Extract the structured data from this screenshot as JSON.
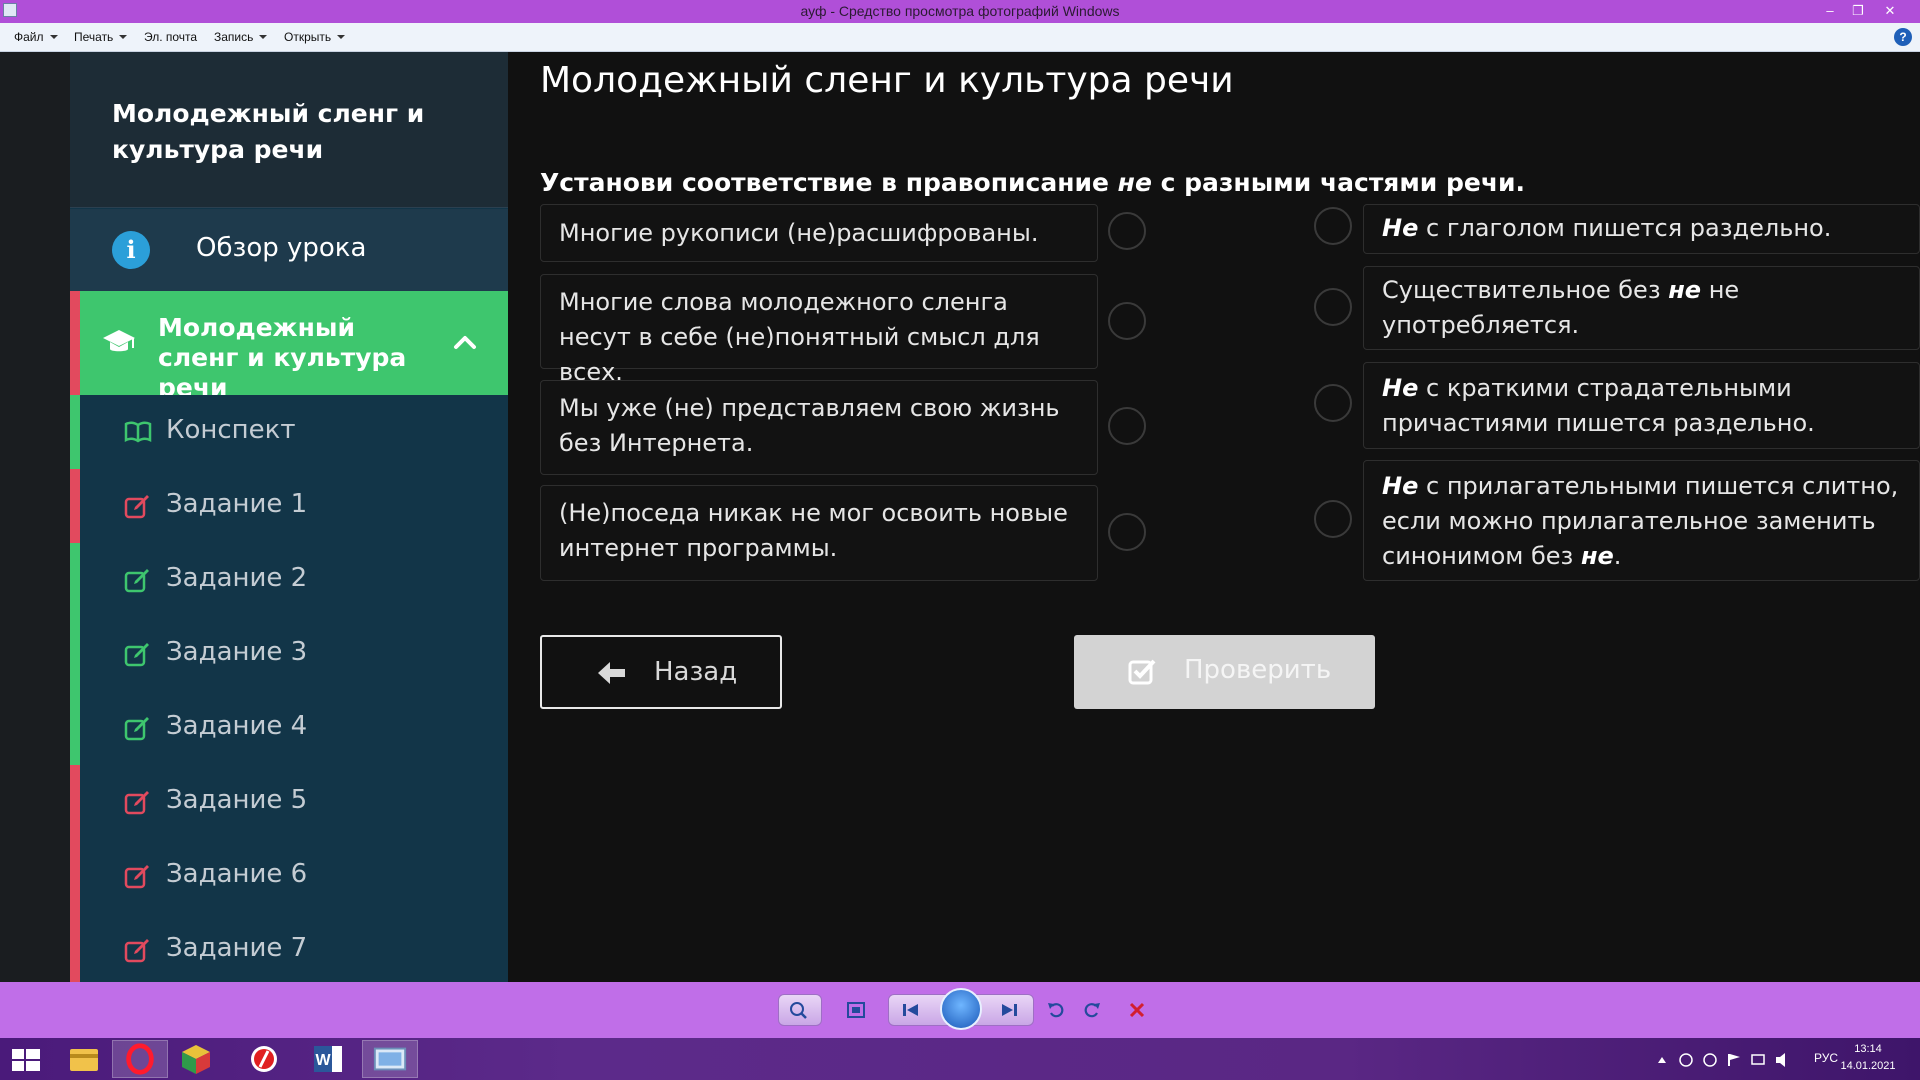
{
  "window": {
    "title": "ауф - Средство просмотра фотографий Windows"
  },
  "menu": {
    "items": [
      {
        "label": "Файл",
        "has_caret": true
      },
      {
        "label": "Печать",
        "has_caret": true
      },
      {
        "label": "Эл. почта",
        "has_caret": false
      },
      {
        "label": "Запись",
        "has_caret": true
      },
      {
        "label": "Открыть",
        "has_caret": true
      }
    ],
    "help_label": "?"
  },
  "sidebar": {
    "course_title": "Молодежный сленг и культура речи",
    "overview_label": "Обзор урока",
    "active_section_label": "Молодежный сленг и культура речи",
    "items": [
      {
        "label": "Конспект",
        "icon": "book-icon",
        "status_color": "#3ec66e"
      },
      {
        "label": "Задание 1",
        "icon": "edit-icon",
        "status_color": "#e24a5e"
      },
      {
        "label": "Задание 2",
        "icon": "edit-icon",
        "status_color": "#3ec66e"
      },
      {
        "label": "Задание 3",
        "icon": "edit-icon",
        "status_color": "#3ec66e"
      },
      {
        "label": "Задание 4",
        "icon": "edit-icon",
        "status_color": "#3ec66e"
      },
      {
        "label": "Задание 5",
        "icon": "edit-icon",
        "status_color": "#e24a5e"
      },
      {
        "label": "Задание 6",
        "icon": "edit-icon",
        "status_color": "#e24a5e"
      },
      {
        "label": "Задание 7",
        "icon": "edit-icon",
        "status_color": "#e24a5e"
      }
    ]
  },
  "main": {
    "page_title": "Молодежный сленг и культура речи",
    "instruction_before": "Установи соответствие в правописание ",
    "instruction_emph": "не",
    "instruction_after": " с разными частями речи.",
    "left_items": [
      "Многие рукописи (не)расшифрованы.",
      "Многие слова молодежного сленга несут в себе (не)понятный смысл для всех.",
      "Мы уже (не) представляем свою жизнь без Интернета.",
      "(Не)поседа никак не мог освоить новые интернет программы."
    ],
    "right_items": [
      {
        "b1": "Не",
        "t1": " с глаголом пишется раздельно.",
        "b2": "",
        "t2": ""
      },
      {
        "b1": "",
        "t1": "Существительное без ",
        "b2": "не",
        "t2": " не употребляется."
      },
      {
        "b1": "Не",
        "t1": " с краткими страдательными причастиями пишется раздельно.",
        "b2": "",
        "t2": ""
      },
      {
        "b1": "Не",
        "t1": " с прилагательными пишется слитно, если можно прилагательное заменить синонимом без ",
        "b2": "не",
        "t2": "."
      }
    ],
    "back_label": "Назад",
    "check_label": "Проверить"
  },
  "colors": {
    "sidebar_bg": "#123548",
    "active_green": "#3ec66e",
    "error_red": "#e24a5e",
    "titlebar": "#b04fd8"
  },
  "taskbar": {
    "language": "РУС",
    "time": "13:14",
    "date": "14.01.2021"
  }
}
